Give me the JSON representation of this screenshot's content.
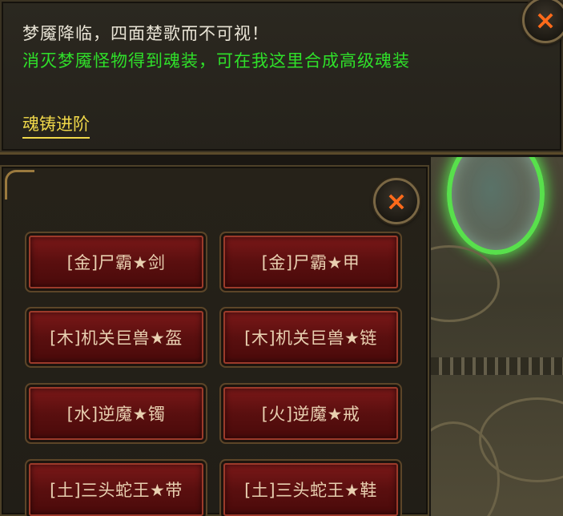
{
  "dialog": {
    "line1": "梦魇降临，四面楚歌而不可视！",
    "line2": "消灭梦魇怪物得到魂装，可在我这里合成高级魂装",
    "link": "魂铸进阶"
  },
  "close_icon": "×",
  "items": [
    {
      "label": "[金]尸霸★剑"
    },
    {
      "label": "[金]尸霸★甲"
    },
    {
      "label": "[木]机关巨兽★盔"
    },
    {
      "label": "[木]机关巨兽★链"
    },
    {
      "label": "[水]逆魔★镯"
    },
    {
      "label": "[火]逆魔★戒"
    },
    {
      "label": "[土]三头蛇王★带"
    },
    {
      "label": "[土]三头蛇王★鞋"
    }
  ],
  "colors": {
    "dialog_text": "#e9e4d6",
    "highlight_green": "#2fe02a",
    "link_yellow": "#f0d84a",
    "button_red": "#6a1212",
    "close_orange": "#ff6a1a"
  }
}
